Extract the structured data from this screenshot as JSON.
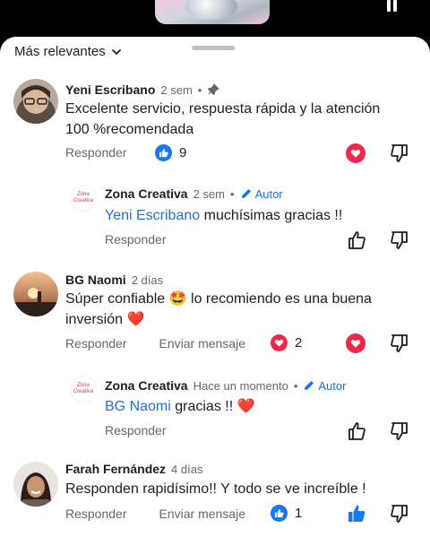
{
  "sort_label": "Más relevantes",
  "comments": [
    {
      "name": "Yeni Escribano",
      "time": "2 sem",
      "text": "Excelente servicio, respuesta rápida y la atención 100 %recomendada",
      "reply_label": "Responder",
      "likes": "9",
      "replies": [
        {
          "name": "Zona Creativa",
          "time": "2 sem",
          "author_badge": "Autor",
          "mention": "Yeni Escribano",
          "text": "muchísimas gracias !!",
          "reply_label": "Responder",
          "logo_text": "Zona Creativa"
        }
      ]
    },
    {
      "name": "BG Naomi",
      "time": "2 días",
      "text_part1": "Súper confiable",
      "emoji1": "🤩",
      "text_part2": "lo recomiendo es una buena inversión",
      "emoji2": "❤️",
      "reply_label": "Responder",
      "message_label": "Enviar mensaje",
      "likes": "2",
      "replies": [
        {
          "name": "Zona Creativa",
          "time": "Hace un momento",
          "author_badge": "Autor",
          "mention": "BG Naomi",
          "text": "gracias !!",
          "emoji": "❤️",
          "reply_label": "Responder",
          "logo_text": "Zona Creativa"
        }
      ]
    },
    {
      "name": "Farah Fernández",
      "time": "4 días",
      "text": "Responden rapidísimo!! Y todo se ve increíble !",
      "reply_label": "Responder",
      "message_label": "Enviar mensaje",
      "likes": "1"
    }
  ],
  "colors": {
    "link": "#216fdb",
    "like": "#1877f2",
    "love": "#f0284a",
    "muted": "#65676b"
  }
}
